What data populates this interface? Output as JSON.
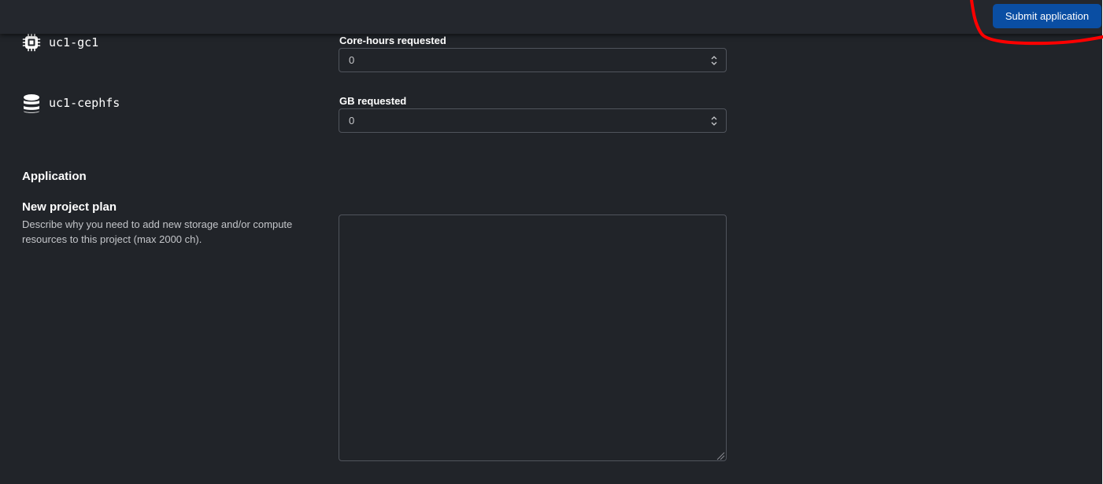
{
  "header": {
    "submit_label": "Submit application",
    "submit_color": "#0a4ea3"
  },
  "resources": [
    {
      "name": "uc1-gc1",
      "icon": "cpu-chip-icon",
      "field_label": "Core-hours requested",
      "value": "0"
    },
    {
      "name": "uc1-cephfs",
      "icon": "database-icon",
      "field_label": "GB requested",
      "value": "0"
    }
  ],
  "application": {
    "section_title": "Application",
    "plan_title": "New project plan",
    "plan_description": "Describe why you need to add new storage and/or compute resources to this project (max 2000 ch).",
    "plan_value": ""
  },
  "colors": {
    "background": "#212429",
    "input_border": "#50545c",
    "annotation_stroke": "#ff0000"
  }
}
